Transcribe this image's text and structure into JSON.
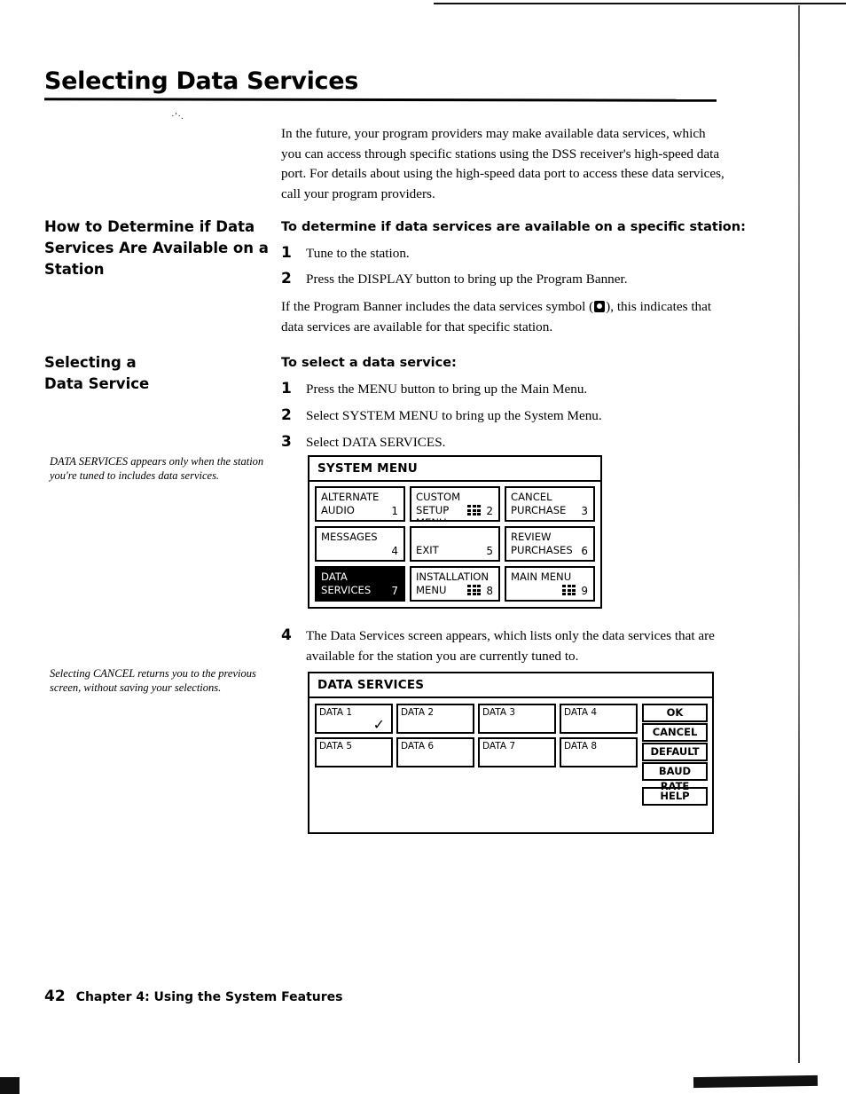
{
  "document": {
    "page_title": "Selecting Data Services",
    "footer": {
      "page_number": "42",
      "chapter": "Chapter 4: Using the System Features"
    }
  },
  "intro": {
    "paragraph": "In the future, your program providers may make available data services, which you can access through specific stations using the DSS receiver's high-speed data port. For details about using the high-speed data port to access these data services, call your program providers."
  },
  "section_determine": {
    "side_heading": "How to Determine if Data Services Are Available on a Station",
    "body_heading": "To determine if data services are available on a specific station:",
    "steps": [
      {
        "num": "1",
        "text": "Tune to the station."
      },
      {
        "num": "2",
        "text": "Press the DISPLAY button to bring up the Program Banner."
      }
    ],
    "note_before_symbol": "If the Program Banner includes the data services symbol (",
    "note_after_symbol": "), this indicates that data services are available for that specific station.",
    "symbol_icon": "data-services-symbol"
  },
  "section_selecting": {
    "side_heading_line1": "Selecting a",
    "side_heading_line2": "Data Service",
    "body_heading": "To select a data service:",
    "steps": [
      {
        "num": "1",
        "text": "Press the MENU button to bring up the Main Menu."
      },
      {
        "num": "2",
        "text": "Select SYSTEM MENU to bring up the System Menu."
      },
      {
        "num": "3",
        "text": "Select DATA SERVICES."
      }
    ],
    "margin_note": "DATA SERVICES appears only when the station you're tuned to includes data services.",
    "step4": {
      "num": "4",
      "text": "The Data Services screen appears, which lists only the data services that are available for the station you are currently tuned to."
    },
    "margin_note_cancel": "Selecting CANCEL returns you to the previous screen, without saving your selections."
  },
  "system_menu": {
    "title": "SYSTEM MENU",
    "items": [
      {
        "label": "ALTERNATE\nAUDIO",
        "num": "1",
        "grid_icon": false,
        "selected": false
      },
      {
        "label": "CUSTOM SETUP\nMENU",
        "num": "2",
        "grid_icon": true,
        "selected": false
      },
      {
        "label": "CANCEL\nPURCHASE",
        "num": "3",
        "grid_icon": false,
        "selected": false
      },
      {
        "label": "MESSAGES",
        "num": "4",
        "grid_icon": false,
        "selected": false
      },
      {
        "label": "\nEXIT",
        "num": "5",
        "grid_icon": false,
        "selected": false
      },
      {
        "label": "REVIEW\nPURCHASES",
        "num": "6",
        "grid_icon": false,
        "selected": false
      },
      {
        "label": "DATA\nSERVICES",
        "num": "7",
        "grid_icon": false,
        "selected": true
      },
      {
        "label": "INSTALLATION\nMENU",
        "num": "8",
        "grid_icon": true,
        "selected": false
      },
      {
        "label": "MAIN MENU\n",
        "num": "9",
        "grid_icon": true,
        "selected": false
      }
    ]
  },
  "data_services_screen": {
    "title": "DATA SERVICES",
    "cells": [
      {
        "label": "DATA 1",
        "checked": true
      },
      {
        "label": "DATA 2",
        "checked": false
      },
      {
        "label": "DATA 3",
        "checked": false
      },
      {
        "label": "DATA 4",
        "checked": false
      },
      {
        "label": "DATA 5",
        "checked": false
      },
      {
        "label": "DATA 6",
        "checked": false
      },
      {
        "label": "DATA 7",
        "checked": false
      },
      {
        "label": "DATA 8",
        "checked": false
      }
    ],
    "buttons": [
      {
        "label": "OK"
      },
      {
        "label": "CANCEL"
      },
      {
        "label": "DEFAULT"
      },
      {
        "label": "BAUD RATE"
      },
      {
        "label": "HELP"
      }
    ],
    "check_glyph": "✓"
  },
  "colors": {
    "ink": "#000000",
    "paper": "#ffffff"
  }
}
